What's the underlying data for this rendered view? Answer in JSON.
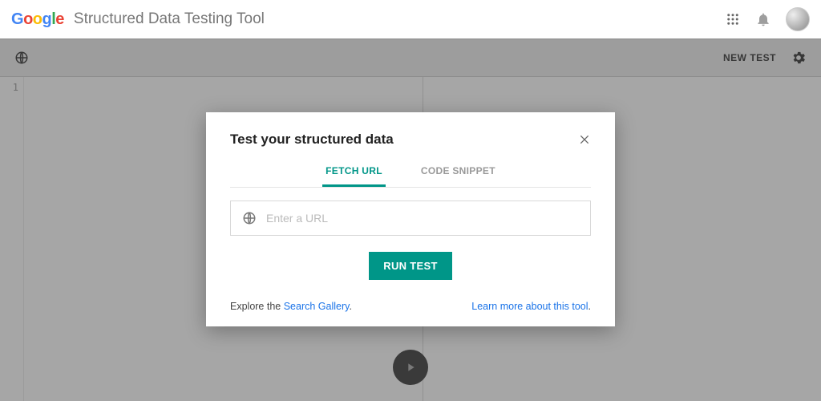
{
  "header": {
    "logo_letters": [
      "G",
      "o",
      "o",
      "g",
      "l",
      "e"
    ],
    "app_title": "Structured Data Testing Tool"
  },
  "toolbar": {
    "new_test_label": "NEW TEST"
  },
  "editor": {
    "line_number": "1"
  },
  "modal": {
    "title": "Test your structured data",
    "tabs": {
      "fetch_url": "FETCH URL",
      "code_snippet": "CODE SNIPPET"
    },
    "input_placeholder": "Enter a URL",
    "run_label": "RUN TEST",
    "footer": {
      "explore_prefix": "Explore the ",
      "search_gallery_link": "Search Gallery",
      "explore_suffix": ".",
      "learn_more_link": "Learn more about this tool",
      "learn_more_suffix": "."
    }
  }
}
